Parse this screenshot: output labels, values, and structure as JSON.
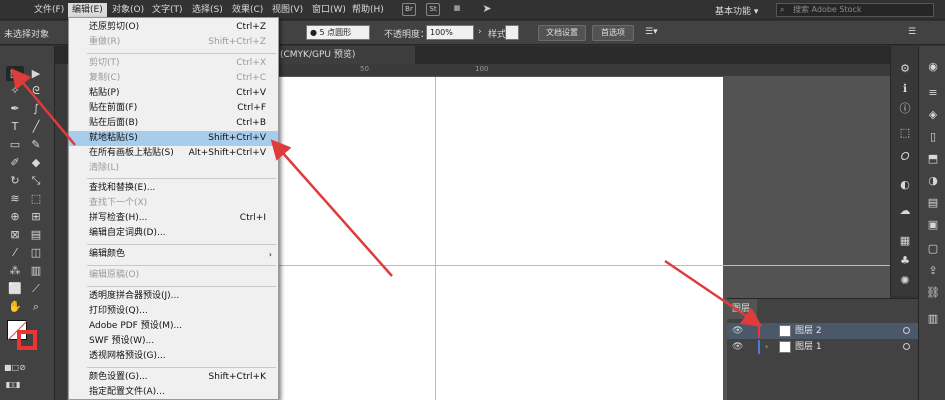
{
  "menubar": {
    "items": [
      "文件(F)",
      "编辑(E)",
      "对象(O)",
      "文字(T)",
      "选择(S)",
      "效果(C)",
      "视图(V)",
      "窗口(W)",
      "帮助(H)"
    ],
    "icons": [
      "Br",
      "St"
    ],
    "workspace": "基本功能 ▾",
    "stock_search_placeholder": "搜索 Adobe Stock"
  },
  "controlbar": {
    "selection_status": "未选择对象",
    "stroke_profile": "5 点圆形",
    "opacity_label": "不透明度：",
    "opacity_value": "100%",
    "style_label": "样式：",
    "doc_setup_button": "文档设置",
    "preferences_button": "首选项"
  },
  "document_tab": {
    "label": "(CMYK/GPU 预览)"
  },
  "ruler": {
    "marks": [
      "50",
      "100"
    ]
  },
  "edit_menu": {
    "items": [
      {
        "label": "还原剪切(O)",
        "shortcut": "Ctrl+Z",
        "disabled": false
      },
      {
        "label": "重做(R)",
        "shortcut": "Shift+Ctrl+Z",
        "disabled": true
      },
      {
        "label": "剪切(T)",
        "shortcut": "Ctrl+X",
        "disabled": true
      },
      {
        "label": "复制(C)",
        "shortcut": "Ctrl+C",
        "disabled": true
      },
      {
        "label": "粘贴(P)",
        "shortcut": "Ctrl+V",
        "disabled": false
      },
      {
        "label": "贴在前面(F)",
        "shortcut": "Ctrl+F",
        "disabled": false
      },
      {
        "label": "贴在后面(B)",
        "shortcut": "Ctrl+B",
        "disabled": false
      },
      {
        "label": "就地粘贴(S)",
        "shortcut": "Shift+Ctrl+V",
        "disabled": false,
        "highlighted": true
      },
      {
        "label": "在所有画板上粘贴(S)",
        "shortcut": "Alt+Shift+Ctrl+V",
        "disabled": false
      },
      {
        "label": "清除(L)",
        "shortcut": "",
        "disabled": true
      },
      {
        "label": "查找和替换(E)...",
        "shortcut": "",
        "disabled": false
      },
      {
        "label": "查找下一个(X)",
        "shortcut": "",
        "disabled": true
      },
      {
        "label": "拼写检查(H)...",
        "shortcut": "Ctrl+I",
        "disabled": false
      },
      {
        "label": "编辑自定词典(D)...",
        "shortcut": "",
        "disabled": false
      },
      {
        "label": "编辑颜色",
        "shortcut": "",
        "disabled": false,
        "submenu": true
      },
      {
        "label": "编辑原稿(O)",
        "shortcut": "",
        "disabled": true
      },
      {
        "label": "透明度拼合器预设(J)...",
        "shortcut": "",
        "disabled": false
      },
      {
        "label": "打印预设(Q)...",
        "shortcut": "",
        "disabled": false
      },
      {
        "label": "Adobe PDF 预设(M)...",
        "shortcut": "",
        "disabled": false
      },
      {
        "label": "SWF 预设(W)...",
        "shortcut": "",
        "disabled": false
      },
      {
        "label": "透视网格预设(G)...",
        "shortcut": "",
        "disabled": false
      },
      {
        "label": "颜色设置(G)...",
        "shortcut": "Shift+Ctrl+K",
        "disabled": false
      },
      {
        "label": "指定配置文件(A)...",
        "shortcut": "",
        "disabled": false
      }
    ],
    "submenu_arrow": "›"
  },
  "layers_panel": {
    "tab_label": "图层",
    "layers": [
      {
        "name": "图层 2",
        "selected": true,
        "expand": ""
      },
      {
        "name": "图层 1",
        "selected": false,
        "expand": "›"
      }
    ],
    "eye_glyph": "👁"
  },
  "colors": {
    "accent_red": "#e33333",
    "highlight": "#a8ccec",
    "guide": "#7fd3e0",
    "layer_selected": "#4b5869"
  }
}
